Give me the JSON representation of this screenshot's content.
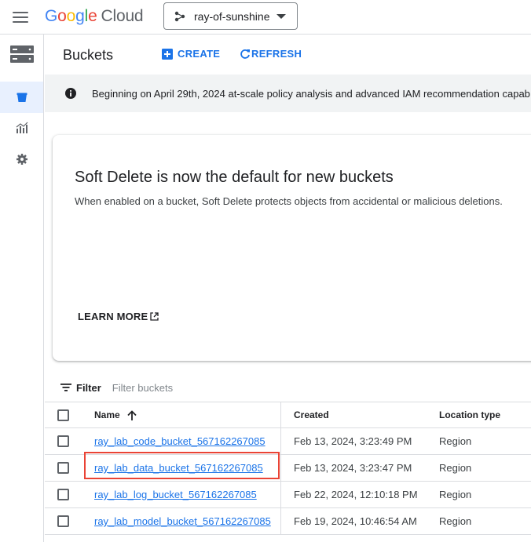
{
  "header": {
    "logo_parts": [
      "G",
      "o",
      "o",
      "g",
      "l",
      "e"
    ],
    "logo_cloud": "Cloud",
    "project_name": "ray-of-sunshine"
  },
  "page": {
    "title": "Buckets",
    "create_label": "CREATE",
    "refresh_label": "REFRESH"
  },
  "banner": {
    "text": "Beginning on April 29th, 2024 at-scale policy analysis and advanced IAM recommendation capab"
  },
  "card": {
    "title": "Soft Delete is now the default for new buckets",
    "description": "When enabled on a bucket, Soft Delete protects objects from accidental or malicious deletions.",
    "learn_more_label": "LEARN MORE"
  },
  "filter": {
    "label": "Filter",
    "placeholder": "Filter buckets"
  },
  "table": {
    "columns": {
      "name": "Name",
      "created": "Created",
      "location_type": "Location type"
    },
    "rows": [
      {
        "name": "ray_lab_code_bucket_567162267085",
        "created": "Feb 13, 2024, 3:23:49 PM",
        "location_type": "Region"
      },
      {
        "name": "ray_lab_data_bucket_567162267085",
        "created": "Feb 13, 2024, 3:23:47 PM",
        "location_type": "Region"
      },
      {
        "name": "ray_lab_log_bucket_567162267085",
        "created": "Feb 22, 2024, 12:10:18 PM",
        "location_type": "Region"
      },
      {
        "name": "ray_lab_model_bucket_567162267085",
        "created": "Feb 19, 2024, 10:46:54 AM",
        "location_type": "Region"
      }
    ]
  },
  "colors": {
    "accent": "#1a73e8",
    "highlight": "#ea4335",
    "rail_active": "#e8f0fe"
  },
  "icons": {
    "menu": "hamburger-icon",
    "storage": "storage-icon",
    "bucket": "bucket-icon",
    "monitoring": "monitoring-icon",
    "settings": "gear-icon",
    "info": "info-icon",
    "filter": "filter-icon",
    "sort": "arrow-up-icon",
    "external": "external-link-icon"
  }
}
